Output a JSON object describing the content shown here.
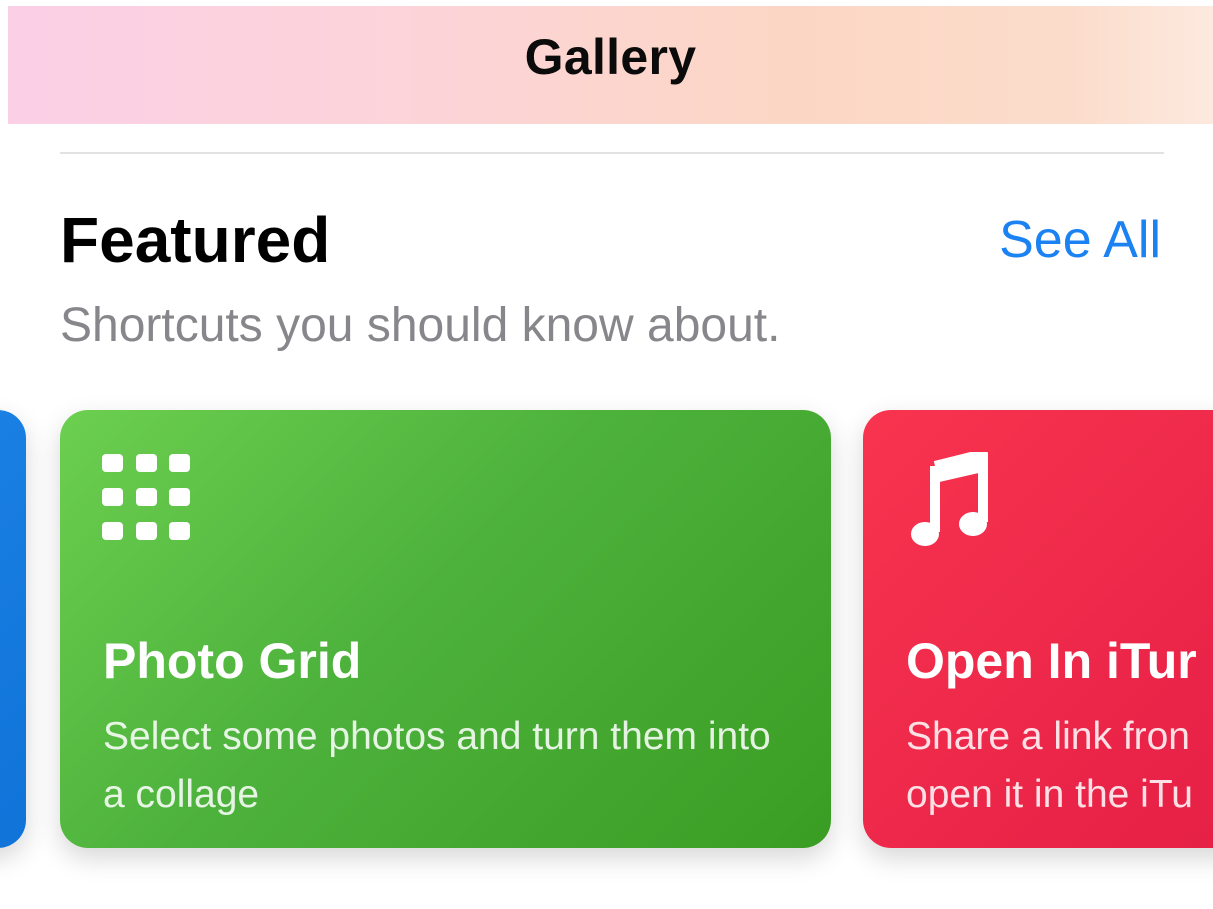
{
  "nav": {
    "title": "Gallery"
  },
  "featured": {
    "title": "Featured",
    "see_all_label": "See All",
    "subtitle": "Shortcuts you should know about."
  },
  "cards": [
    {
      "color": "#1a82f2",
      "title": "",
      "description": ""
    },
    {
      "color": "#4db23c",
      "icon": "grid-icon",
      "title": "Photo Grid",
      "description": "Select some photos and turn them into a collage"
    },
    {
      "color": "#ea2448",
      "icon": "music-note-icon",
      "title": "Open In iTur",
      "description_lines": [
        "Share a link fron",
        "open it in the iTu"
      ]
    }
  ],
  "colors": {
    "accent": "#1a82f2",
    "subtitle": "#86868b"
  }
}
